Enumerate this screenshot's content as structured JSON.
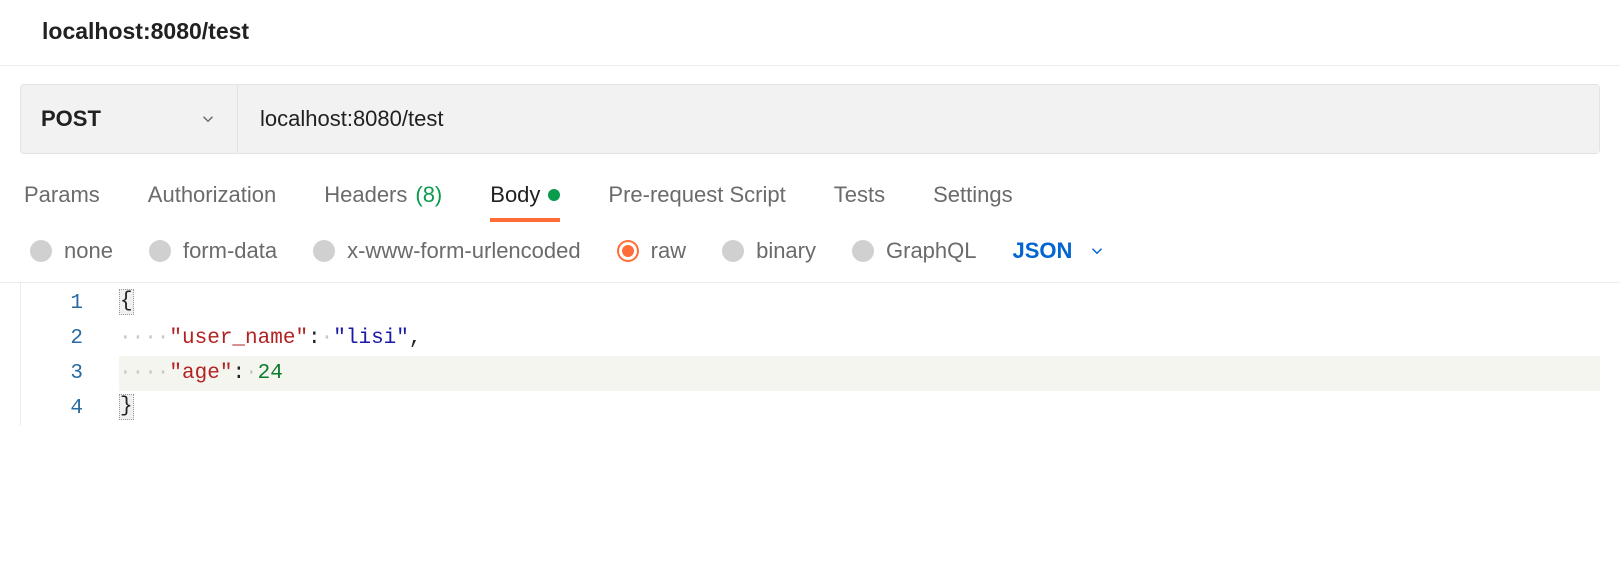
{
  "header": {
    "title": "localhost:8080/test"
  },
  "request": {
    "method": "POST",
    "url": "localhost:8080/test"
  },
  "tabs": {
    "params": "Params",
    "authorization": "Authorization",
    "headers_label": "Headers",
    "headers_count": "(8)",
    "body": "Body",
    "prerequest": "Pre-request Script",
    "tests": "Tests",
    "settings": "Settings"
  },
  "body_types": {
    "none": "none",
    "formdata": "form-data",
    "urlencoded": "x-www-form-urlencoded",
    "raw": "raw",
    "binary": "binary",
    "graphql": "GraphQL",
    "format": "JSON"
  },
  "editor": {
    "line_numbers": [
      "1",
      "2",
      "3",
      "4"
    ],
    "line1_brace": "{",
    "line2_key": "\"user_name\"",
    "line2_val": "\"lisi\"",
    "line3_key": "\"age\"",
    "line3_val": "24",
    "line4_brace": "}",
    "colon": ":",
    "comma": ",",
    "dots": "····"
  }
}
